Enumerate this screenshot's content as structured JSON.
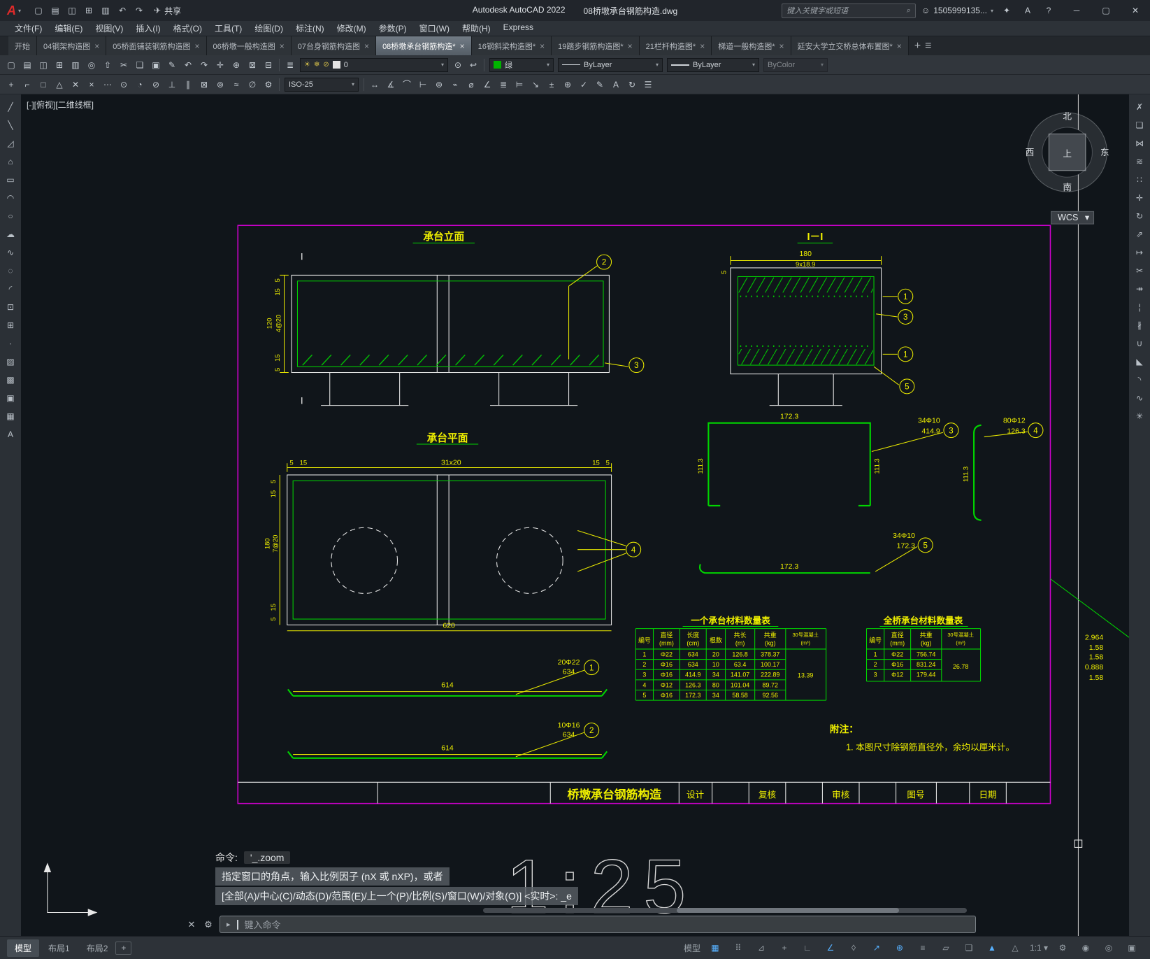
{
  "window": {
    "logo_letter": "A",
    "app_title": "Autodesk AutoCAD 2022",
    "doc_title": "08桥墩承台钢筋构造.dwg",
    "share_label": "共享",
    "search_placeholder": "键入关键字或短语",
    "user_id": "1505999135...",
    "quick_icons": [
      {
        "n": "qat-new-icon",
        "g": "▢"
      },
      {
        "n": "qat-open-icon",
        "g": "▤"
      },
      {
        "n": "qat-save-icon",
        "g": "◫"
      },
      {
        "n": "qat-saveas-icon",
        "g": "⊞"
      },
      {
        "n": "qat-plot-icon",
        "g": "▥"
      },
      {
        "n": "qat-undo-icon",
        "g": "↶"
      },
      {
        "n": "qat-redo-icon",
        "g": "↷"
      }
    ]
  },
  "menubar": {
    "items": [
      {
        "label": "文件(F)"
      },
      {
        "label": "编辑(E)"
      },
      {
        "label": "视图(V)"
      },
      {
        "label": "插入(I)"
      },
      {
        "label": "格式(O)"
      },
      {
        "label": "工具(T)"
      },
      {
        "label": "绘图(D)"
      },
      {
        "label": "标注(N)"
      },
      {
        "label": "修改(M)"
      },
      {
        "label": "参数(P)"
      },
      {
        "label": "窗口(W)"
      },
      {
        "label": "帮助(H)"
      },
      {
        "label": "Express"
      }
    ]
  },
  "filetabs": {
    "tabs": [
      {
        "label": "开始",
        "closable": false
      },
      {
        "label": "04钢架构造图",
        "closable": true
      },
      {
        "label": "05桥面铺装钢筋构造图",
        "closable": true
      },
      {
        "label": "06桥墩一般构造图",
        "closable": true
      },
      {
        "label": "07台身钢筋构造图",
        "closable": true
      },
      {
        "label": "08桥墩承台钢筋构造*",
        "closable": true,
        "active": true
      },
      {
        "label": "16钢斜梁构造图*",
        "closable": true
      },
      {
        "label": "19踏步钢筋构造图*",
        "closable": true
      },
      {
        "label": "21栏杆构造图*",
        "closable": true
      },
      {
        "label": "梯道一般构造图*",
        "closable": true
      },
      {
        "label": "延安大学立交桥总体布置图*",
        "closable": true
      }
    ]
  },
  "toolbar_row1": {
    "icons": [
      {
        "n": "new-drawing",
        "g": "▢"
      },
      {
        "n": "open-drawing",
        "g": "▤"
      },
      {
        "n": "save-drawing",
        "g": "◫"
      },
      {
        "n": "save-as",
        "g": "⊞"
      },
      {
        "n": "plot",
        "g": "▥"
      },
      {
        "n": "plot-preview",
        "g": "◎"
      },
      {
        "n": "publish",
        "g": "⇧"
      },
      {
        "n": "cut-clip",
        "g": "✂"
      },
      {
        "n": "copy-clip",
        "g": "❏"
      },
      {
        "n": "paste-clip",
        "g": "▣"
      },
      {
        "n": "match-properties",
        "g": "✎"
      },
      {
        "n": "undo",
        "g": "↶"
      },
      {
        "n": "redo",
        "g": "↷"
      },
      {
        "n": "pan-realtime",
        "g": "✛"
      },
      {
        "n": "zoom-realtime",
        "g": "⊕"
      },
      {
        "n": "zoom-window",
        "g": "⊠"
      },
      {
        "n": "zoom-previous",
        "g": "⊟"
      }
    ],
    "layer_value": "0",
    "color_value": "绿",
    "linetype_value": "ByLayer",
    "lineweight_value": "ByLayer",
    "plotstyle_value": "ByColor"
  },
  "toolbar_row2": {
    "icons_left": [
      {
        "n": "snap-tracking",
        "g": "+"
      },
      {
        "n": "snap-from",
        "g": "⌐"
      },
      {
        "n": "snap-endpoint",
        "g": "□"
      },
      {
        "n": "snap-midpoint",
        "g": "△"
      },
      {
        "n": "snap-intersection",
        "g": "✕"
      },
      {
        "n": "snap-apparent",
        "g": "×"
      },
      {
        "n": "snap-extension",
        "g": "⋯"
      },
      {
        "n": "snap-center",
        "g": "⊙"
      },
      {
        "n": "snap-quadrant",
        "g": "◔"
      },
      {
        "n": "snap-tangent",
        "g": "⊘"
      },
      {
        "n": "snap-perpendicular",
        "g": "⊥"
      },
      {
        "n": "snap-parallel",
        "g": "∥"
      },
      {
        "n": "snap-insert",
        "g": "⊠"
      },
      {
        "n": "snap-node",
        "g": "⊚"
      },
      {
        "n": "snap-nearest",
        "g": "≈"
      },
      {
        "n": "snap-none",
        "g": "∅"
      },
      {
        "n": "osnap-settings",
        "g": "⚙"
      }
    ],
    "dimstyle_value": "ISO-25",
    "icons_right": [
      {
        "n": "dim-linear",
        "g": "↔"
      },
      {
        "n": "dim-aligned",
        "g": "∡"
      },
      {
        "n": "dim-arc-length",
        "g": "⌒"
      },
      {
        "n": "dim-ordinate",
        "g": "⊢"
      },
      {
        "n": "dim-radius",
        "g": "⊚"
      },
      {
        "n": "dim-jogged",
        "g": "⌁"
      },
      {
        "n": "dim-diameter",
        "g": "⌀"
      },
      {
        "n": "dim-angular",
        "g": "∠"
      },
      {
        "n": "dim-quick",
        "g": "≣"
      },
      {
        "n": "dim-baseline",
        "g": "⊨"
      },
      {
        "n": "dim-leader",
        "g": "↘"
      },
      {
        "n": "dim-tolerance",
        "g": "±"
      },
      {
        "n": "dim-center-mark",
        "g": "⊕"
      },
      {
        "n": "dim-inspect",
        "g": "✓"
      },
      {
        "n": "dim-edit",
        "g": "✎"
      },
      {
        "n": "dim-text-edit",
        "g": "A"
      },
      {
        "n": "dim-update",
        "g": "↻"
      },
      {
        "n": "dim-style-manager",
        "g": "☰"
      }
    ]
  },
  "side_left": {
    "icons": [
      {
        "n": "draw-line",
        "g": "╱"
      },
      {
        "n": "draw-xline",
        "g": "╲"
      },
      {
        "n": "draw-polyline",
        "g": "◿"
      },
      {
        "n": "draw-polygon",
        "g": "⌂"
      },
      {
        "n": "draw-rectangle",
        "g": "▭"
      },
      {
        "n": "draw-arc",
        "g": "◠"
      },
      {
        "n": "draw-circle",
        "g": "○"
      },
      {
        "n": "draw-revcloud",
        "g": "☁"
      },
      {
        "n": "draw-spline",
        "g": "∿"
      },
      {
        "n": "draw-ellipse",
        "g": "◌"
      },
      {
        "n": "draw-ellipse-arc",
        "g": "◜"
      },
      {
        "n": "draw-insert-block",
        "g": "⊡"
      },
      {
        "n": "draw-make-block",
        "g": "⊞"
      },
      {
        "n": "draw-point",
        "g": "∙"
      },
      {
        "n": "draw-hatch",
        "g": "▨"
      },
      {
        "n": "draw-gradient",
        "g": "▩"
      },
      {
        "n": "draw-region",
        "g": "▣"
      },
      {
        "n": "draw-table",
        "g": "▦"
      },
      {
        "n": "draw-mtext",
        "g": "A"
      }
    ]
  },
  "side_right": {
    "icons": [
      {
        "n": "modify-erase",
        "g": "✗"
      },
      {
        "n": "modify-copy",
        "g": "❏"
      },
      {
        "n": "modify-mirror",
        "g": "⋈"
      },
      {
        "n": "modify-offset",
        "g": "≋"
      },
      {
        "n": "modify-array",
        "g": "∷"
      },
      {
        "n": "modify-move",
        "g": "✛"
      },
      {
        "n": "modify-rotate",
        "g": "↻"
      },
      {
        "n": "modify-scale",
        "g": "⇗"
      },
      {
        "n": "modify-stretch",
        "g": "↦"
      },
      {
        "n": "modify-trim",
        "g": "✂"
      },
      {
        "n": "modify-extend",
        "g": "↠"
      },
      {
        "n": "modify-break-point",
        "g": "¦"
      },
      {
        "n": "modify-break",
        "g": "∦"
      },
      {
        "n": "modify-join",
        "g": "∪"
      },
      {
        "n": "modify-chamfer",
        "g": "◣"
      },
      {
        "n": "modify-fillet",
        "g": "◝"
      },
      {
        "n": "modify-blend",
        "g": "∿"
      },
      {
        "n": "modify-explode",
        "g": "✳"
      }
    ]
  },
  "viewport": {
    "controls_label": "[-][俯视][二维线框]",
    "compass": {
      "north": "北",
      "south": "南",
      "west": "西",
      "east": "东",
      "top": "上"
    },
    "wcs_label": "WCS"
  },
  "drawing": {
    "views": {
      "elev_title": "承台立面",
      "section_title": "I－I",
      "plan_title": "承台平面"
    },
    "elev": {
      "d5a": "5",
      "d15a": "15",
      "d120": "120",
      "d4at20": "4@20",
      "d15b": "15",
      "d5b": "5",
      "section_mark": "I",
      "callout_top": "2",
      "callout_bottom": "3"
    },
    "section": {
      "dim_width": "180",
      "dim_spacing": "9x18.9",
      "dim_5": "5",
      "callout_1a": "1",
      "callout_3": "3",
      "callout_1b": "1",
      "callout_5": "5"
    },
    "plan": {
      "t5a": "5",
      "t15a": "15",
      "t31x20": "31x20",
      "t15b": "15",
      "t5b": "5",
      "l5a": "5",
      "l15a": "15",
      "l180": "180",
      "l7at20": "7@20",
      "l15b": "15",
      "l5b": "5",
      "bottom": "620",
      "callout": "4"
    },
    "details": {
      "stirrup": {
        "dim_top": "172.3",
        "dim_side_left": "111.3",
        "dim_side_right": "111.3",
        "callout": "3",
        "mark": "34Φ10",
        "length": "414.9"
      },
      "vbar": {
        "dim_side": "111.3",
        "callout": "4",
        "mark": "80Φ12",
        "length": "126.3"
      },
      "hookbar": {
        "dim": "172.3",
        "callout": "5",
        "mark": "34Φ10",
        "length": "172.3"
      },
      "bar1": {
        "dim": "614",
        "mark": "20Φ22",
        "length": "634",
        "callout": "1"
      },
      "bar2": {
        "dim": "614",
        "mark": "10Φ16",
        "length": "634",
        "callout": "2"
      }
    },
    "table_one": {
      "title": "一个承台材料数量表",
      "headers": [
        [
          "编号"
        ],
        [
          "直径",
          "(mm)"
        ],
        [
          "长度",
          "(cm)"
        ],
        [
          "根数"
        ],
        [
          "共长",
          "(m)"
        ],
        [
          "共重",
          "(kg)"
        ],
        [
          "30号混凝土",
          "(m³)"
        ]
      ],
      "rows": [
        [
          "1",
          "Φ22",
          "634",
          "20",
          "126.8",
          "378.37"
        ],
        [
          "2",
          "Φ16",
          "634",
          "10",
          "63.4",
          "100.17"
        ],
        [
          "3",
          "Φ16",
          "414.9",
          "34",
          "141.07",
          "222.89"
        ],
        [
          "4",
          "Φ12",
          "126.3",
          "80",
          "101.04",
          "89.72"
        ],
        [
          "5",
          "Φ16",
          "172.3",
          "34",
          "58.58",
          "92.56"
        ]
      ],
      "concrete": "13.39"
    },
    "table_all": {
      "title": "全桥承台材料数量表",
      "headers": [
        [
          "编号"
        ],
        [
          "直径",
          "(mm)"
        ],
        [
          "共重",
          "(kg)"
        ],
        [
          "30号混凝土",
          "(m³)"
        ]
      ],
      "rows": [
        [
          "1",
          "Φ22",
          "756.74"
        ],
        [
          "2",
          "Φ16",
          "831.24"
        ],
        [
          "3",
          "Φ12",
          "179.44"
        ]
      ],
      "concrete": "26.78"
    },
    "notes": {
      "title": "附注：",
      "line1": "1. 本图尺寸除钢筋直径外，余均以厘米计。"
    },
    "titleblock": {
      "drawing_name": "桥墩承台钢筋构造",
      "design": "设计",
      "check": "复核",
      "review": "审核",
      "sheet_no": "图号",
      "date": "日期"
    },
    "scale_text": "1:25",
    "right_values": [
      "2.964",
      "1.58",
      "1.58",
      "0.888",
      "1.58"
    ]
  },
  "commandline": {
    "line1_label": "命令:",
    "line1_command": "'_.zoom",
    "line2": "指定窗口的角点，输入比例因子 (nX 或 nXP)，或者",
    "line3": "[全部(A)/中心(C)/动态(D)/范围(E)/上一个(P)/比例(S)/窗口(W)/对象(O)] <实时>: _e",
    "input_placeholder": "键入命令"
  },
  "statusbar": {
    "layout_tabs": [
      {
        "label": "模型",
        "active": true
      },
      {
        "label": "布局1"
      },
      {
        "label": "布局2"
      }
    ],
    "new_layout": "+",
    "icons": [
      {
        "n": "model-paper-toggle",
        "g": "模型"
      },
      {
        "n": "grid-display",
        "g": "▦",
        "active": true
      },
      {
        "n": "snap-mode",
        "g": "⠿"
      },
      {
        "n": "infer-constraints",
        "g": "⊿"
      },
      {
        "n": "dynamic-input",
        "g": "+"
      },
      {
        "n": "ortho-mode",
        "g": "∟"
      },
      {
        "n": "polar-tracking",
        "g": "∠",
        "active": true
      },
      {
        "n": "isometric-drafting",
        "g": "◊"
      },
      {
        "n": "object-snap-tracking",
        "g": "↗",
        "active": true
      },
      {
        "n": "object-snap",
        "g": "⊕",
        "active": true
      },
      {
        "n": "lineweight-display",
        "g": "≡"
      },
      {
        "n": "transparency-display",
        "g": "▱"
      },
      {
        "n": "selection-cycling",
        "g": "❏"
      },
      {
        "n": "annotation-visibility",
        "g": "▲",
        "active": true
      },
      {
        "n": "annotation-autoscale",
        "g": "△"
      },
      {
        "n": "annotation-scale",
        "g": "1:1 ▾"
      },
      {
        "n": "workspace-switching",
        "g": "⚙"
      },
      {
        "n": "annotation-monitor",
        "g": "◉"
      },
      {
        "n": "isolate-objects",
        "g": "◎"
      },
      {
        "n": "clean-screen",
        "g": "▣"
      }
    ]
  }
}
